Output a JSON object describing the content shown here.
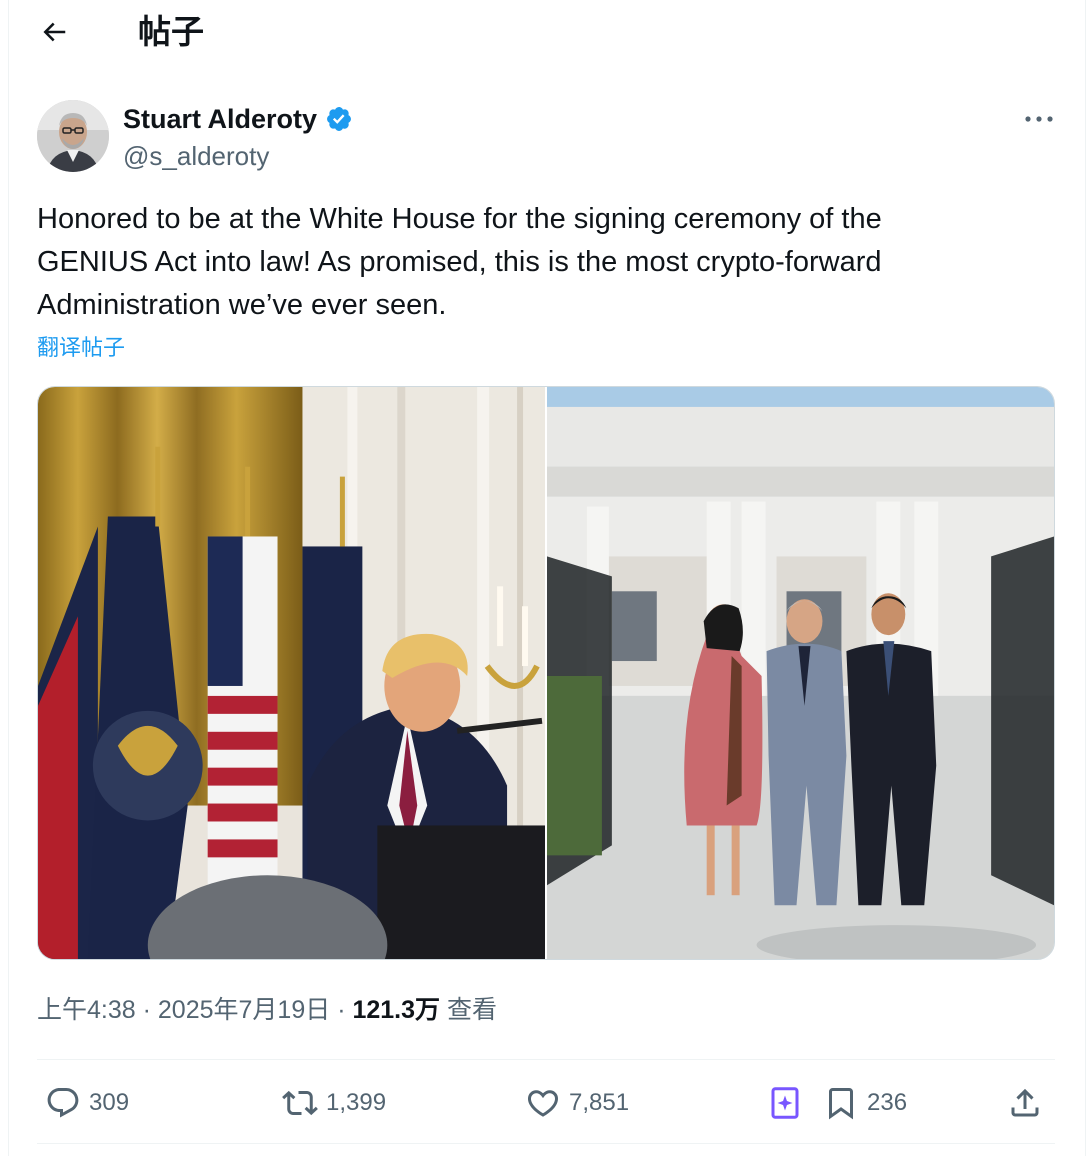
{
  "header": {
    "title": "帖子",
    "back_icon": "arrow-left-icon"
  },
  "author": {
    "name": "Stuart Alderoty",
    "handle": "@s_alderoty",
    "verified": true,
    "verified_color": "#1d9bf0"
  },
  "post": {
    "lines": [
      "Honored to be at the White House for the signing ceremony of the",
      "GENIUS Act into law! As promised, this is the most crypto-forward",
      "Administration we’ve ever seen."
    ],
    "translate_label": "翻译帖子"
  },
  "meta": {
    "time": "上午4:38",
    "separator": "·",
    "date": "2025年7月19日",
    "views_count": "121.3万",
    "views_label": "查看"
  },
  "actions": {
    "replies": "309",
    "reposts": "1,399",
    "likes": "7,851",
    "bookmarks": "236"
  },
  "colors": {
    "accent": "#1d9bf0",
    "secondary_text": "#536471",
    "grok_purple": "#7856ff"
  }
}
